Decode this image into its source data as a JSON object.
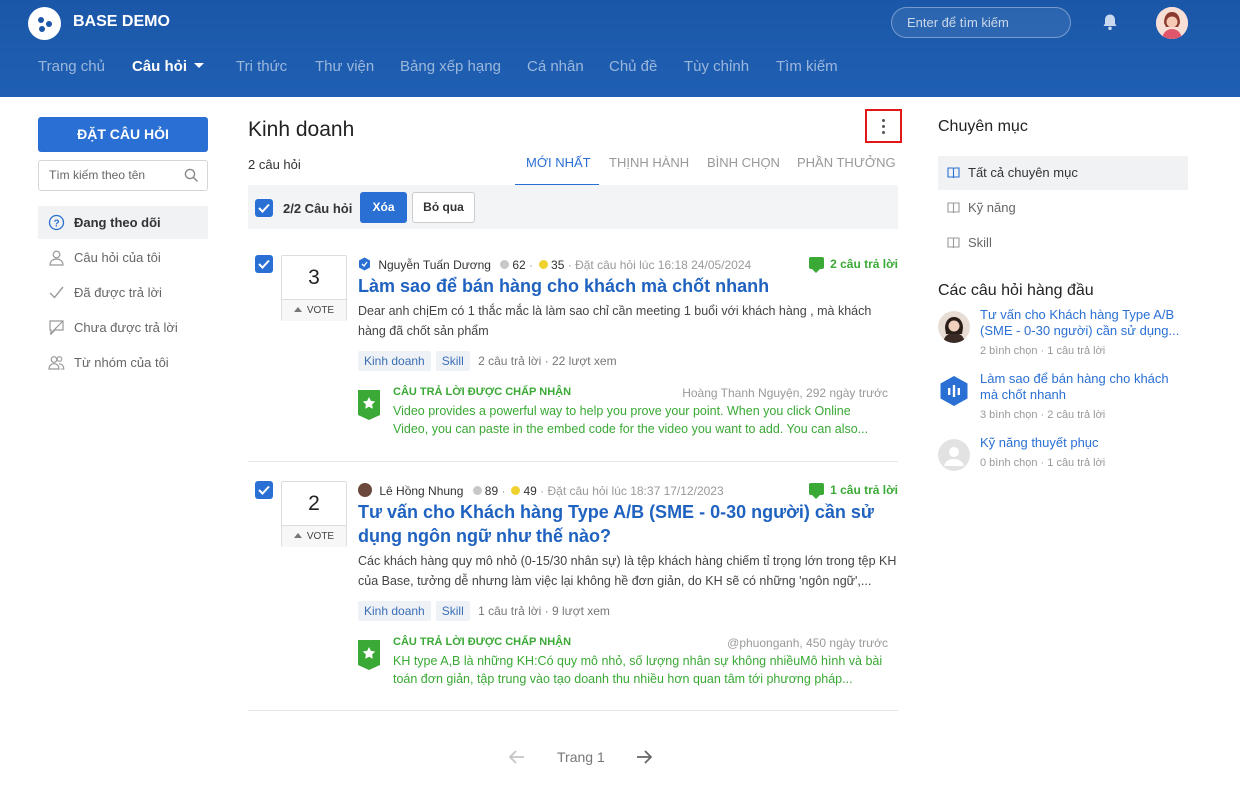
{
  "app": {
    "brand": "BASE DEMO",
    "search_placeholder": "Enter để tìm kiếm"
  },
  "nav": [
    {
      "label": "Trang chủ"
    },
    {
      "label": "Câu hỏi"
    },
    {
      "label": "Tri thức"
    },
    {
      "label": "Thư viện"
    },
    {
      "label": "Bảng xếp hạng"
    },
    {
      "label": "Cá nhân"
    },
    {
      "label": "Chủ đề"
    },
    {
      "label": "Tùy chỉnh"
    },
    {
      "label": "Tìm kiếm"
    }
  ],
  "sidebar": {
    "ask_button": "ĐẶT CÂU HỎI",
    "search_placeholder": "Tìm kiếm theo tên",
    "items": [
      {
        "label": "Đang theo dõi",
        "icon": "question-circle-icon"
      },
      {
        "label": "Câu hỏi của tôi",
        "icon": "user-icon"
      },
      {
        "label": "Đã được trả lời",
        "icon": "check-icon"
      },
      {
        "label": "Chưa được trả lời",
        "icon": "unanswered-icon"
      },
      {
        "label": "Từ nhóm của tôi",
        "icon": "group-icon"
      }
    ]
  },
  "main": {
    "title": "Kinh doanh",
    "count": "2 câu hỏi",
    "tabs": [
      {
        "label": "MỚI NHẤT"
      },
      {
        "label": "THỊNH HÀNH"
      },
      {
        "label": "BÌNH CHỌN"
      },
      {
        "label": "PHẦN THƯỞNG"
      }
    ],
    "bulk": {
      "selected": "2/2 Câu hỏi",
      "delete": "Xóa",
      "skip": "Bỏ qua"
    },
    "questions": [
      {
        "votes": "3",
        "vote_label": "VOTE",
        "author": "Nguyễn Tuấn Dương",
        "points_gray": "62",
        "points_gold": "35",
        "asked": "Đặt câu hỏi lúc 16:18 24/05/2024",
        "answers": "2 câu trả lời",
        "title": "Làm sao để bán hàng cho khách mà chốt nhanh",
        "body": "Dear anh chịEm có 1 thắc mắc là làm sao chỉ cần meeting 1 buổi với khách hàng , mà khách hàng đã chốt sản phẩm",
        "tags": [
          "Kinh doanh",
          "Skill"
        ],
        "stats": "2 câu trả lời · 22 lượt xem",
        "accepted_label": "CÂU TRẢ LỜI ĐƯỢC CHẤP NHẬN",
        "accepted_by": "Hoàng Thanh Nguyện, 292 ngày trước",
        "accepted_text": "Video provides a powerful way to help you prove your point. When you click Online Video, you can paste in the embed code for the video you want to add. You can also..."
      },
      {
        "votes": "2",
        "vote_label": "VOTE",
        "author": "Lê Hồng Nhung",
        "points_gray": "89",
        "points_gold": "49",
        "asked": "Đặt câu hỏi lúc 18:37 17/12/2023",
        "answers": "1 câu trả lời",
        "title": "Tư vấn cho Khách hàng Type A/B (SME - 0-30 người) cần sử dụng ngôn ngữ như thế nào?",
        "body": "Các khách hàng quy mô nhỏ (0-15/30 nhân sự) là tệp khách hàng chiếm tỉ trọng lớn trong tệp KH của Base, tưởng dễ nhưng làm việc lại không hề đơn giản, do KH sẽ có những 'ngôn ngữ',...",
        "tags": [
          "Kinh doanh",
          "Skill"
        ],
        "stats": "1 câu trả lời · 9 lượt xem",
        "accepted_label": "CÂU TRẢ LỜI ĐƯỢC CHẤP NHẬN",
        "accepted_by": "@phuonganh, 450 ngày trước",
        "accepted_text": "KH type A,B là những KH:Có quy mô nhỏ, số lượng nhân sự không nhiềuMô hình và bài toán đơn giản, tập trung vào tạo doanh thu nhiều hơn quan tâm tới phương pháp..."
      }
    ],
    "pager": {
      "label": "Trang 1"
    }
  },
  "right": {
    "categories_title": "Chuyên mục",
    "categories": [
      {
        "label": "Tất cả chuyên mục"
      },
      {
        "label": "Kỹ năng"
      },
      {
        "label": "Skill"
      }
    ],
    "top_title": "Các câu hỏi hàng đầu",
    "top_questions": [
      {
        "title": "Tư vấn cho Khách hàng Type A/B (SME - 0-30 người) cần sử dụng...",
        "meta": "2 bình chọn · 1 câu trả lời"
      },
      {
        "title": "Làm sao để bán hàng cho khách mà chốt nhanh",
        "meta": "3 bình chọn · 2 câu trả lời"
      },
      {
        "title": "Kỹ năng thuyết phục",
        "meta": "0 bình chọn · 1 câu trả lời"
      }
    ]
  },
  "colors": {
    "header": "#1b57a8",
    "accent": "#2a70d4",
    "success": "#3aa935",
    "highlight_border": "#e01818"
  }
}
